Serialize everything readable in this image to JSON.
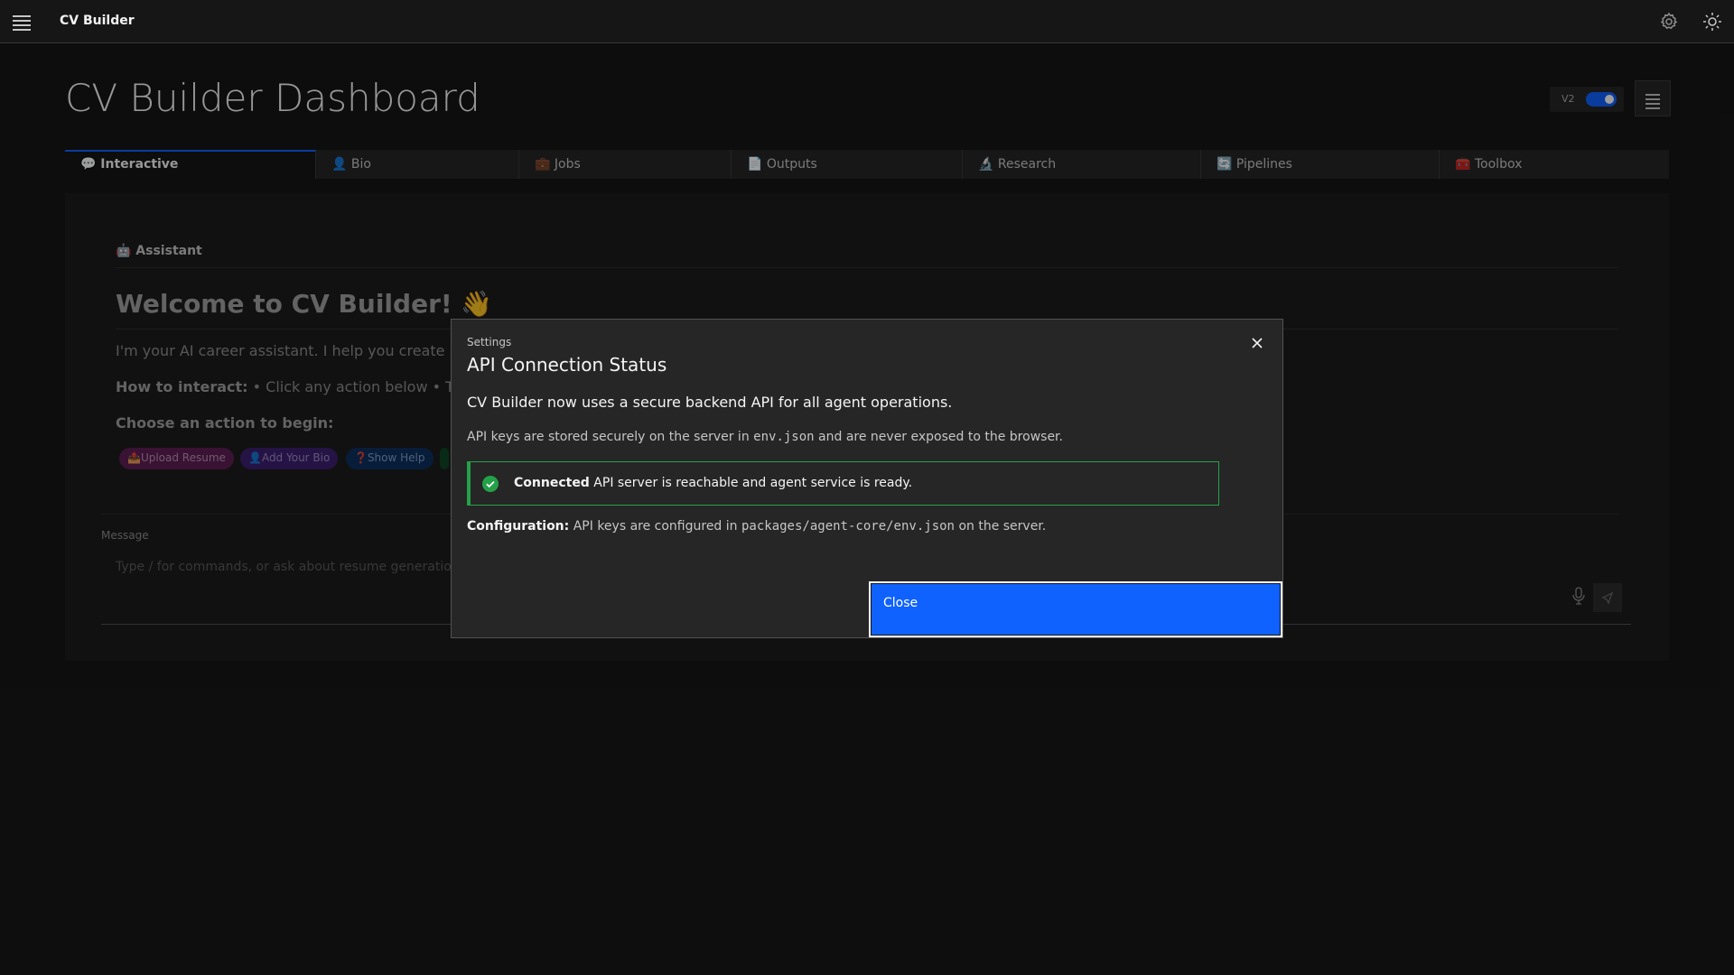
{
  "app": {
    "title": "CV Builder"
  },
  "page": {
    "title": "CV Builder Dashboard",
    "version_label": "V2"
  },
  "tabs": [
    {
      "label": "💬 Interactive",
      "active": true
    },
    {
      "label": "👤 Bio"
    },
    {
      "label": "💼 Jobs"
    },
    {
      "label": "📄 Outputs"
    },
    {
      "label": "🔬 Research"
    },
    {
      "label": "🔄 Pipelines"
    },
    {
      "label": "🧰 Toolbox"
    }
  ],
  "assistant": {
    "header": "🤖 Assistant",
    "welcome": "Welcome to CV Builder! 👋",
    "intro": "I'm your AI career assistant. I help you create resur",
    "howto_label": "How to interact:",
    "howto_text": " • Click any action below • Type que",
    "choose": "Choose an action to begin:",
    "actions": [
      "📤Upload Resume",
      "👤Add Your Bio",
      "❓Show Help",
      ""
    ]
  },
  "message": {
    "label": "Message",
    "placeholder": "Type / for commands, or ask about resume generation, job"
  },
  "modal": {
    "label": "Settings",
    "title": "API Connection Status",
    "subtitle": "CV Builder now uses a secure backend API for all agent operations.",
    "keys_prefix": "API keys are stored securely on the server in ",
    "keys_file": "env.json",
    "keys_suffix": " and are never exposed to the browser.",
    "status_title": "Connected",
    "status_text": " API server is reachable and agent service is ready.",
    "config_label": "Configuration:",
    "config_prefix": " API keys are configured in ",
    "config_path": "packages/agent-core/env.json",
    "config_suffix": " on the server.",
    "close_button": "Close"
  },
  "colors": {
    "accent": "#0f62fe",
    "success": "#24a148",
    "background": "#161616"
  }
}
